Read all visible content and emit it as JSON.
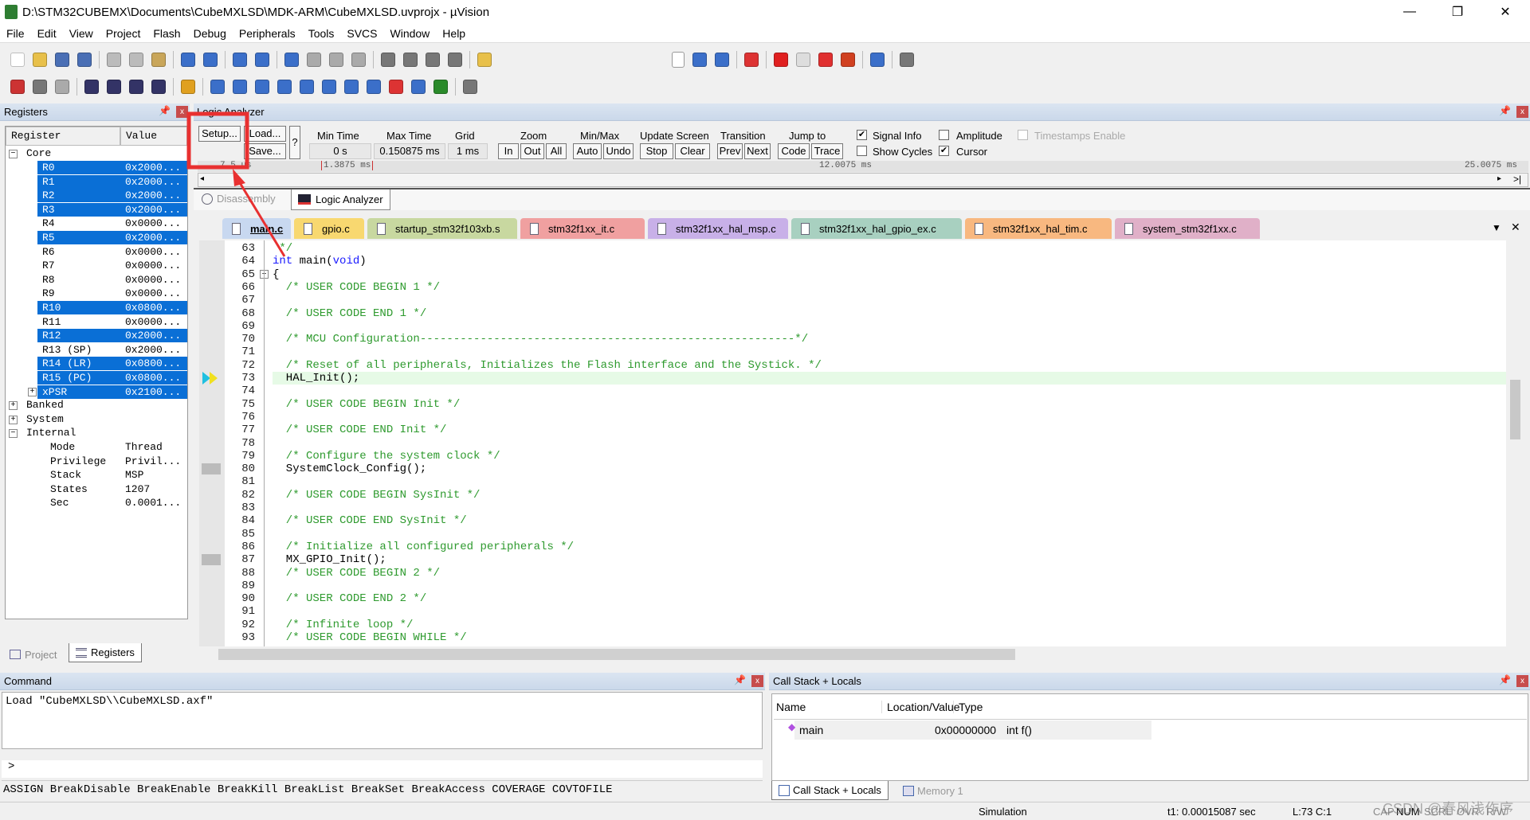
{
  "window": {
    "title": "D:\\STM32CUBEMX\\Documents\\CubeMXLSD\\MDK-ARM\\CubeMXLSD.uvprojx - µVision",
    "minimize": "—",
    "restore": "❐",
    "close": "✕"
  },
  "menu": [
    "File",
    "Edit",
    "View",
    "Project",
    "Flash",
    "Debug",
    "Peripherals",
    "Tools",
    "SVCS",
    "Window",
    "Help"
  ],
  "toolbar1": [
    [
      "new-file-icon",
      "#fff"
    ],
    [
      "open-icon",
      "#e8c04a"
    ],
    [
      "save-icon",
      "#4a6fb5"
    ],
    [
      "save-all-icon",
      "#4a6fb5"
    ],
    [
      "sep",
      ""
    ],
    [
      "cut-icon",
      "#bbb"
    ],
    [
      "copy-icon",
      "#bbb"
    ],
    [
      "paste-icon",
      "#c9a65a"
    ],
    [
      "sep",
      ""
    ],
    [
      "undo-icon",
      "#3b6fc9"
    ],
    [
      "redo-icon",
      "#3b6fc9"
    ],
    [
      "sep",
      ""
    ],
    [
      "back-icon",
      "#3b6fc9"
    ],
    [
      "forward-icon",
      "#3b6fc9"
    ],
    [
      "sep",
      ""
    ],
    [
      "bookmark-icon",
      "#3b6fc9"
    ],
    [
      "prev-bookmark-icon",
      "#aaa"
    ],
    [
      "next-bookmark-icon",
      "#aaa"
    ],
    [
      "clear-bookmarks-icon",
      "#aaa"
    ],
    [
      "sep",
      ""
    ],
    [
      "indent-icon",
      "#777"
    ],
    [
      "unindent-icon",
      "#777"
    ],
    [
      "comment-icon",
      "#777"
    ],
    [
      "uncomment-icon",
      "#777"
    ],
    [
      "sep",
      ""
    ],
    [
      "find-in-files-icon",
      "#e8c04a"
    ]
  ],
  "toolbar1_right": [
    [
      "find-dropdown",
      "#fff"
    ],
    [
      "find-icon",
      "#3b6fc9"
    ],
    [
      "debug-settings-icon",
      "#3b6fc9"
    ],
    [
      "sep",
      ""
    ],
    [
      "start-debug-icon",
      "#d33"
    ],
    [
      "sep",
      ""
    ],
    [
      "breakpoint-icon",
      "#e02020"
    ],
    [
      "disable-breakpoint-icon",
      "#ddd"
    ],
    [
      "kill-breakpoints-icon",
      "#e03030"
    ],
    [
      "kill-all-icon",
      "#d04020"
    ],
    [
      "sep",
      ""
    ],
    [
      "window-layout-icon",
      "#3b6fc9"
    ],
    [
      "sep",
      ""
    ],
    [
      "configure-icon",
      "#777"
    ]
  ],
  "toolbar2": [
    [
      "reset-icon",
      "#c33"
    ],
    [
      "run-icon",
      "#777"
    ],
    [
      "stop-icon",
      "#aaa"
    ],
    [
      "sep",
      ""
    ],
    [
      "step-icon",
      "#336"
    ],
    [
      "step-over-icon",
      "#336"
    ],
    [
      "step-out-icon",
      "#336"
    ],
    [
      "run-to-cursor-icon",
      "#336"
    ],
    [
      "sep",
      ""
    ],
    [
      "show-next-statement-icon",
      "#e0a020"
    ],
    [
      "sep",
      ""
    ],
    [
      "command-window-icon",
      "#3b6fc9"
    ],
    [
      "disassembly-window-icon",
      "#3b6fc9"
    ],
    [
      "symbols-window-icon",
      "#3b6fc9"
    ],
    [
      "registers-window-icon",
      "#3b6fc9"
    ],
    [
      "call-stack-window-icon",
      "#3b6fc9"
    ],
    [
      "watch-windows-icon",
      "#3b6fc9"
    ],
    [
      "memory-windows-icon",
      "#3b6fc9"
    ],
    [
      "serial-windows-icon",
      "#3b6fc9"
    ],
    [
      "analysis-windows-icon",
      "#d33"
    ],
    [
      "trace-windows-icon",
      "#3b6fc9"
    ],
    [
      "system-viewer-icon",
      "#2a8a2a"
    ],
    [
      "sep",
      ""
    ],
    [
      "toolbox-icon",
      "#777"
    ]
  ],
  "registers": {
    "title": "Registers",
    "col_register": "Register",
    "col_value": "Value",
    "groups": {
      "core": "Core",
      "banked": "Banked",
      "system": "System",
      "internal": "Internal"
    },
    "core": [
      {
        "name": "R0",
        "value": "0x2000...",
        "sel": true
      },
      {
        "name": "R1",
        "value": "0x2000...",
        "sel": true
      },
      {
        "name": "R2",
        "value": "0x2000...",
        "sel": true
      },
      {
        "name": "R3",
        "value": "0x2000...",
        "sel": true
      },
      {
        "name": "R4",
        "value": "0x0000...",
        "sel": false
      },
      {
        "name": "R5",
        "value": "0x2000...",
        "sel": true
      },
      {
        "name": "R6",
        "value": "0x0000...",
        "sel": false
      },
      {
        "name": "R7",
        "value": "0x0000...",
        "sel": false
      },
      {
        "name": "R8",
        "value": "0x0000...",
        "sel": false
      },
      {
        "name": "R9",
        "value": "0x0000...",
        "sel": false
      },
      {
        "name": "R10",
        "value": "0x0800...",
        "sel": true
      },
      {
        "name": "R11",
        "value": "0x0000...",
        "sel": false
      },
      {
        "name": "R12",
        "value": "0x2000...",
        "sel": true
      },
      {
        "name": "R13 (SP)",
        "value": "0x2000...",
        "sel": false
      },
      {
        "name": "R14 (LR)",
        "value": "0x0800...",
        "sel": true
      },
      {
        "name": "R15 (PC)",
        "value": "0x0800...",
        "sel": true
      },
      {
        "name": "xPSR",
        "value": "0x2100...",
        "sel": true
      }
    ],
    "internal": [
      {
        "name": "Mode",
        "value": "Thread"
      },
      {
        "name": "Privilege",
        "value": "Privil..."
      },
      {
        "name": "Stack",
        "value": "MSP"
      },
      {
        "name": "States",
        "value": "1207"
      },
      {
        "name": "Sec",
        "value": "0.0001..."
      }
    ],
    "tabs": {
      "project": "Project",
      "registers": "Registers"
    }
  },
  "logic_analyzer": {
    "title": "Logic Analyzer",
    "setup": "Setup...",
    "load": "Load...",
    "save": "Save...",
    "help": "?",
    "min_time_label": "Min Time",
    "min_time": "0 s",
    "max_time_label": "Max Time",
    "max_time": "0.150875 ms",
    "grid_label": "Grid",
    "grid": "1 ms",
    "zoom_label": "Zoom",
    "zoom_in": "In",
    "zoom_out": "Out",
    "zoom_all": "All",
    "minmax_label": "Min/Max",
    "auto": "Auto",
    "undo": "Undo",
    "update_label": "Update Screen",
    "stop": "Stop",
    "clear": "Clear",
    "transition_label": "Transition",
    "prev": "Prev",
    "next": "Next",
    "jump_label": "Jump to",
    "code": "Code",
    "trace": "Trace",
    "signal_info": {
      "label": "Signal Info",
      "checked": true
    },
    "amplitude": {
      "label": "Amplitude",
      "checked": false
    },
    "timestamps": {
      "label": "Timestamps Enable",
      "checked": false
    },
    "show_cycles": {
      "label": "Show Cycles",
      "checked": false
    },
    "cursor": {
      "label": "Cursor",
      "checked": true
    },
    "ruler_left": "7.5 us",
    "ruler_cursor": "1.3875 ms",
    "ruler_mid": "12.0075 ms",
    "ruler_right": "25.0075 ms"
  },
  "view_tabs": {
    "disassembly": "Disassembly",
    "logic_analyzer": "Logic Analyzer"
  },
  "file_tabs": [
    {
      "name": "main.c",
      "color": "#c8d8f0",
      "active": true
    },
    {
      "name": "gpio.c",
      "color": "#f8d870"
    },
    {
      "name": "startup_stm32f103xb.s",
      "color": "#c8d8a0"
    },
    {
      "name": "stm32f1xx_it.c",
      "color": "#f0a0a0"
    },
    {
      "name": "stm32f1xx_hal_msp.c",
      "color": "#c8b0e8"
    },
    {
      "name": "stm32f1xx_hal_gpio_ex.c",
      "color": "#a8d0c0"
    },
    {
      "name": "stm32f1xx_hal_tim.c",
      "color": "#f8b880"
    },
    {
      "name": "system_stm32f1xx.c",
      "color": "#e0b0c8"
    }
  ],
  "code": [
    {
      "n": "63",
      "segs": [
        [
          " */",
          "cm"
        ]
      ]
    },
    {
      "n": "64",
      "segs": [
        [
          "int",
          "kw"
        ],
        [
          " main(",
          "tx"
        ],
        [
          "void",
          "kw"
        ],
        [
          ")",
          "tx"
        ]
      ]
    },
    {
      "n": "65",
      "segs": [
        [
          "{",
          "tx"
        ]
      ]
    },
    {
      "n": "66",
      "segs": [
        [
          "  /* USER CODE BEGIN 1 */",
          "cm"
        ]
      ]
    },
    {
      "n": "67",
      "segs": []
    },
    {
      "n": "68",
      "segs": [
        [
          "  /* USER CODE END 1 */",
          "cm"
        ]
      ]
    },
    {
      "n": "69",
      "segs": []
    },
    {
      "n": "70",
      "segs": [
        [
          "  /* MCU Configuration--------------------------------------------------------*/",
          "cm"
        ]
      ]
    },
    {
      "n": "71",
      "segs": []
    },
    {
      "n": "72",
      "segs": [
        [
          "  /* Reset of all peripherals, Initializes the Flash interface and the Systick. */",
          "cm"
        ]
      ]
    },
    {
      "n": "73",
      "segs": [
        [
          "  HAL_Init();",
          "tx"
        ]
      ],
      "current": true
    },
    {
      "n": "74",
      "segs": []
    },
    {
      "n": "75",
      "segs": [
        [
          "  /* USER CODE BEGIN Init */",
          "cm"
        ]
      ]
    },
    {
      "n": "76",
      "segs": []
    },
    {
      "n": "77",
      "segs": [
        [
          "  /* USER CODE END Init */",
          "cm"
        ]
      ]
    },
    {
      "n": "78",
      "segs": []
    },
    {
      "n": "79",
      "segs": [
        [
          "  /* Configure the system clock */",
          "cm"
        ]
      ]
    },
    {
      "n": "80",
      "segs": [
        [
          "  SystemClock_Config();",
          "tx"
        ]
      ],
      "mark": true
    },
    {
      "n": "81",
      "segs": []
    },
    {
      "n": "82",
      "segs": [
        [
          "  /* USER CODE BEGIN SysInit */",
          "cm"
        ]
      ]
    },
    {
      "n": "83",
      "segs": []
    },
    {
      "n": "84",
      "segs": [
        [
          "  /* USER CODE END SysInit */",
          "cm"
        ]
      ]
    },
    {
      "n": "85",
      "segs": []
    },
    {
      "n": "86",
      "segs": [
        [
          "  /* Initialize all configured peripherals */",
          "cm"
        ]
      ]
    },
    {
      "n": "87",
      "segs": [
        [
          "  MX_GPIO_Init();",
          "tx"
        ]
      ],
      "mark": true
    },
    {
      "n": "88",
      "segs": [
        [
          "  /* USER CODE BEGIN 2 */",
          "cm"
        ]
      ]
    },
    {
      "n": "89",
      "segs": []
    },
    {
      "n": "90",
      "segs": [
        [
          "  /* USER CODE END 2 */",
          "cm"
        ]
      ]
    },
    {
      "n": "91",
      "segs": []
    },
    {
      "n": "92",
      "segs": [
        [
          "  /* Infinite loop */",
          "cm"
        ]
      ]
    },
    {
      "n": "93",
      "segs": [
        [
          "  /* USER CODE BEGIN WHILE */",
          "cm"
        ]
      ]
    }
  ],
  "command": {
    "title": "Command",
    "output": "Load \"CubeMXLSD\\\\CubeMXLSD.axf\"",
    "prompt": ">",
    "help": "ASSIGN BreakDisable BreakEnable BreakKill BreakList BreakSet BreakAccess COVERAGE COVTOFILE"
  },
  "callstack": {
    "title": "Call Stack + Locals",
    "cols": [
      "Name",
      "Location/Value",
      "Type"
    ],
    "rows": [
      {
        "name": "main",
        "value": "0x00000000",
        "type": "int f()"
      }
    ],
    "tabs": {
      "callstack": "Call Stack + Locals",
      "memory": "Memory 1"
    }
  },
  "status": {
    "mode": "Simulation",
    "t1": "t1: 0.00015087 sec",
    "pos": "L:73 C:1",
    "cap": "CAP",
    "num": "NUM",
    "scrl": "SCRL",
    "ovr": "OVR",
    "rw": "R/W",
    "watermark": "CSDN @春风浅作序"
  },
  "colors": {
    "selection": "#0a6fd6",
    "annotation": "#e83030",
    "current_line": "#e6fae6"
  }
}
